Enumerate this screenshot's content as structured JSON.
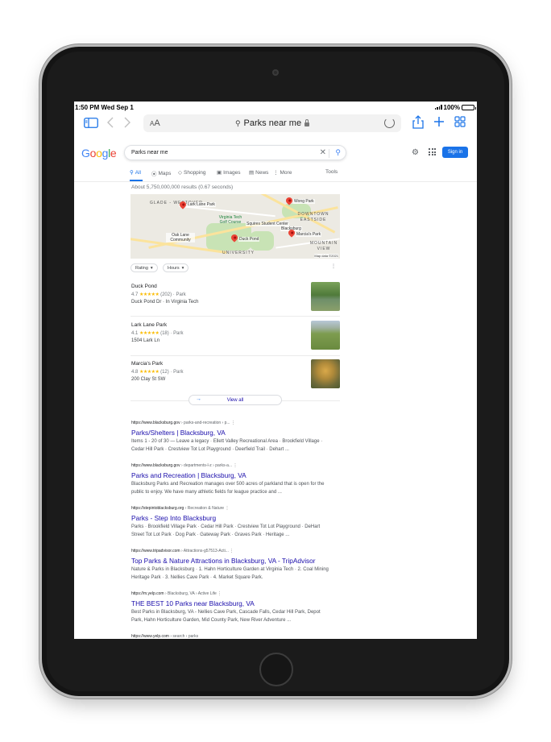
{
  "status_bar": {
    "time": "1:50 PM",
    "date": "Wed Sep 1",
    "battery": "100%"
  },
  "safari": {
    "reader_label": "AA",
    "url": "Parks near me"
  },
  "google": {
    "logo": "Google",
    "query": "Parks near me",
    "signin": "Sign in",
    "tabs": [
      "All",
      "Maps",
      "Shopping",
      "Images",
      "News",
      "More",
      "Tools"
    ],
    "result_stats": "About 5,750,000,000 results (0.67 seconds)"
  },
  "map": {
    "labels": [
      "GLADE - WESTOVER",
      "DOWNTOWN EASTSIDE",
      "MOUNTAIN VIEW",
      "UNIVERSITY"
    ],
    "pois": [
      "Lark Lane Park",
      "Virginia Tech Golf Course",
      "Oak Lane Community",
      "Squires Student Center",
      "Blacksburg",
      "Duck Pond",
      "Wong Park",
      "Marcia's Park"
    ],
    "credit": "Map data ©2021"
  },
  "filters": [
    "Rating",
    "Hours"
  ],
  "places": [
    {
      "name": "Duck Pond",
      "rating": "4.7",
      "stars": "★★★★★",
      "reviews": "(202)",
      "type": "Park",
      "address": "Duck Pond Dr · In Virginia Tech"
    },
    {
      "name": "Lark Lane Park",
      "rating": "4.1",
      "stars": "★★★★★",
      "reviews": "(18)",
      "type": "Park",
      "address": "1504 Lark Ln"
    },
    {
      "name": "Marcia's Park",
      "rating": "4.8",
      "stars": "★★★★★",
      "reviews": "(12)",
      "type": "Park",
      "address": "200 Clay St SW"
    }
  ],
  "view_all": "View all",
  "results": [
    {
      "url": "https://www.blacksburg.gov",
      "crumb": " › parks-and-recreation › p...",
      "title": "Parks/Shelters | Blacksburg, VA",
      "snippet": "Items 1 - 20 of 30 — Leave a legacy · Ellett Valley Recreational Area · Brookfield Village · Cedar Hill Park · Crestview Tot Lot Playground · Deerfield Trail · Dehart ..."
    },
    {
      "url": "https://www.blacksburg.gov",
      "crumb": " › departments-l-z › parks-a...",
      "title": "Parks and Recreation | Blacksburg, VA",
      "snippet": "Blacksburg Parks and Recreation manages over 500 acres of parkland that is open for the public to enjoy. We have many athletic fields for league practice and ..."
    },
    {
      "url": "https://stepintoblacksburg.org",
      "crumb": " › Recreation & Nature",
      "title": "Parks - Step Into Blacksburg",
      "snippet": "Parks · Brookfield Village Park · Cedar Hill Park · Crestview Tot Lot Playground · DeHart Street Tot Lot Park · Dog Park · Gateway Park · Graves Park · Heritage ..."
    },
    {
      "url": "https://www.tripadvisor.com",
      "crumb": " › Attractions-g57513-Acti...",
      "title": "Top Parks & Nature Attractions in Blacksburg, VA - TripAdvisor",
      "snippet": "Nature & Parks in Blacksburg · 1. Hahn Horticulture Garden at Virginia Tech · 2. Coal Mining Heritage Park · 3. Nellies Cave Park · 4. Market Square Park."
    },
    {
      "url": "https://m.yelp.com",
      "crumb": " › Blacksburg, VA › Active Life",
      "title": "THE BEST 10 Parks near Blacksburg, VA",
      "snippet": "Best Parks in Blacksburg, VA - Nellies Cave Park, Cascade Falls, Cedar Hill Park, Depot Park, Hahn Horticulture Garden, Mid County Park, New River Adventure ..."
    },
    {
      "url": "https://www.yelp.com",
      "crumb": " › search › parks",
      "title": "",
      "snippet": ""
    }
  ],
  "colors": {
    "link": "#1a0dab",
    "accent": "#1a73e8",
    "star": "#fbbc04",
    "pin": "#ea4335"
  }
}
